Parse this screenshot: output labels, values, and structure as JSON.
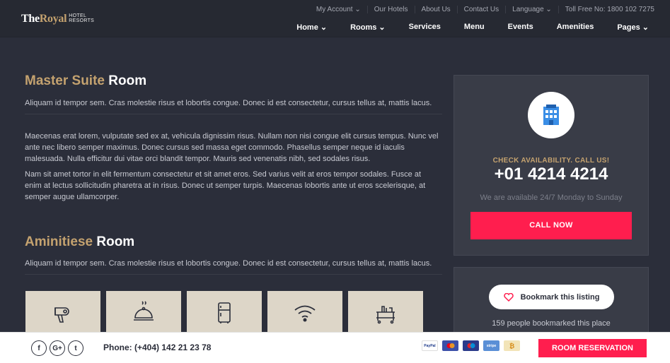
{
  "brand": {
    "the": "The",
    "royal": "Royal",
    "sub1": "HOTEL",
    "sub2": "RESORTS"
  },
  "topbar": [
    "My Account ⌄",
    "Our Hotels",
    "About Us",
    "Contact Us",
    "Language ⌄",
    "Toll Free No: 1800 102 7275"
  ],
  "nav": [
    "Home ⌄",
    "Rooms ⌄",
    "Services",
    "Menu",
    "Events",
    "Amenities",
    "Pages ⌄"
  ],
  "master": {
    "title_gold": "Master Suite",
    "title_white": "Room",
    "lead": "Aliquam id tempor sem. Cras molestie risus et lobortis congue. Donec id est consectetur, cursus tellus at, mattis lacus.",
    "p1": "Maecenas erat lorem, vulputate sed ex at, vehicula dignissim risus. Nullam non nisi congue elit cursus tempus. Nunc vel ante nec libero semper maximus. Donec cursus sed massa eget commodo. Phasellus semper neque id iaculis malesuada. Nulla efficitur dui vitae orci blandit tempor. Mauris sed venenatis nibh, sed sodales risus.",
    "p2": "Nam sit amet tortor in elit fermentum consectetur et sit amet eros. Sed varius velit at eros tempor sodales. Fusce at enim at lectus sollicitudin pharetra at in risus. Donec ut semper turpis. Maecenas lobortis ante ut eros scelerisque, at semper augue ullamcorper."
  },
  "amenities": {
    "title_gold": "Aminitiese",
    "title_white": "Room",
    "lead": "Aliquam id tempor sem. Cras molestie risus et lobortis congue. Donec id est consectetur, cursus tellus at, mattis lacus.",
    "icons": [
      "hair-dryer-icon",
      "room-service-icon",
      "fridge-icon",
      "wifi-icon",
      "trolley-icon"
    ]
  },
  "booking": {
    "check": "CHECK AVAILABILITY. CALL US!",
    "phone": "+01 4214 4214",
    "avail": "We are available 24/7 Monday to Sunday",
    "call_btn": "CALL NOW"
  },
  "bookmark": {
    "btn": "Bookmark this listing",
    "count": "159 people bookmarked this place"
  },
  "footer": {
    "social": [
      "f",
      "G+",
      "t"
    ],
    "phone": "Phone: (+404) 142 21 23 78",
    "payments": [
      {
        "label": "PayPal",
        "color": "#ffffff",
        "text": "#1e3a8a"
      },
      {
        "label": "MC",
        "color": "#3b4fa8",
        "text": "#ffffff"
      },
      {
        "label": "MC",
        "color": "#2b3a8a",
        "text": "#ffffff"
      },
      {
        "label": "stripe",
        "color": "#5a8fd6",
        "text": "#ffffff"
      },
      {
        "label": "₿",
        "color": "#f2e4b8",
        "text": "#d68a14"
      }
    ],
    "reserve_btn": "ROOM RESERVATION"
  },
  "colors": {
    "accent": "#ff1e4e",
    "gold": "#c4a26f",
    "bg": "#2b2e3a"
  }
}
